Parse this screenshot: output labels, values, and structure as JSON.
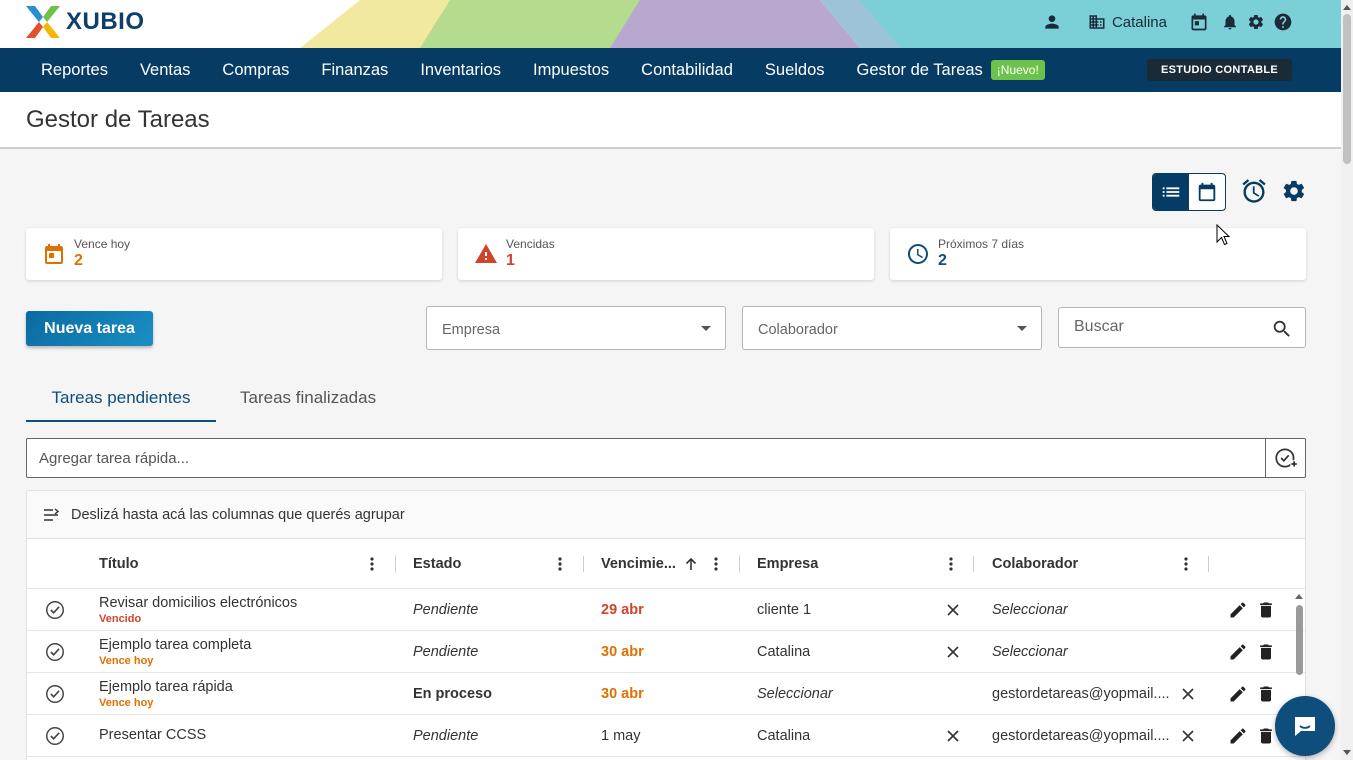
{
  "app": {
    "logo_text": "XUBIO"
  },
  "topbar": {
    "user_name": "Catalina"
  },
  "nav": {
    "items": [
      "Reportes",
      "Ventas",
      "Compras",
      "Finanzas",
      "Inventarios",
      "Impuestos",
      "Contabilidad",
      "Sueldos",
      "Gestor de Tareas"
    ],
    "new_badge": "¡Nuevo!",
    "studio_button": "ESTUDIO CONTABLE"
  },
  "page": {
    "title": "Gestor de Tareas"
  },
  "stats": [
    {
      "label": "Vence hoy",
      "value": "2",
      "icon": "calendar-icon",
      "color": "#e07000"
    },
    {
      "label": "Vencidas",
      "value": "1",
      "icon": "warning-icon",
      "color": "#d2432b"
    },
    {
      "label": "Próximos 7 días",
      "value": "2",
      "icon": "clock-icon",
      "color": "#0e4e7d"
    }
  ],
  "filters": {
    "new_task": "Nueva tarea",
    "empresa_label": "Empresa",
    "colaborador_label": "Colaborador",
    "search_placeholder": "Buscar"
  },
  "tabs": {
    "active": "Tareas pendientes",
    "inactive": "Tareas finalizadas"
  },
  "quick_add": {
    "placeholder": "Agregar tarea rápida..."
  },
  "grid": {
    "group_hint": "Deslizá hasta acá las columnas que querés agrupar",
    "columns": [
      "Título",
      "Estado",
      "Vencimie...",
      "Empresa",
      "Colaborador"
    ],
    "rows": [
      {
        "title": "Revisar domicilios electrónicos",
        "subtitle": "Vencido",
        "status": "Pendiente",
        "due": "29 abr",
        "company": "cliente 1",
        "collaborator": "Seleccionar"
      },
      {
        "title": "Ejemplo tarea completa",
        "subtitle": "Vence hoy",
        "status": "Pendiente",
        "due": "30 abr",
        "company": "Catalina",
        "collaborator": "Seleccionar"
      },
      {
        "title": "Ejemplo tarea rápida",
        "subtitle": "Vence hoy",
        "status": "En proceso",
        "due": "30 abr",
        "company": "Seleccionar",
        "collaborator": "gestordetareas@yopmail...."
      },
      {
        "title": "Presentar CCSS",
        "subtitle": "",
        "status": "Pendiente",
        "due": "1 may",
        "company": "Catalina",
        "collaborator": "gestordetareas@yopmail...."
      }
    ]
  },
  "colors": {
    "nav_bg": "#063b63",
    "overdue": "#d2432b",
    "today": "#e07000",
    "accent": "#0e4e7d"
  }
}
